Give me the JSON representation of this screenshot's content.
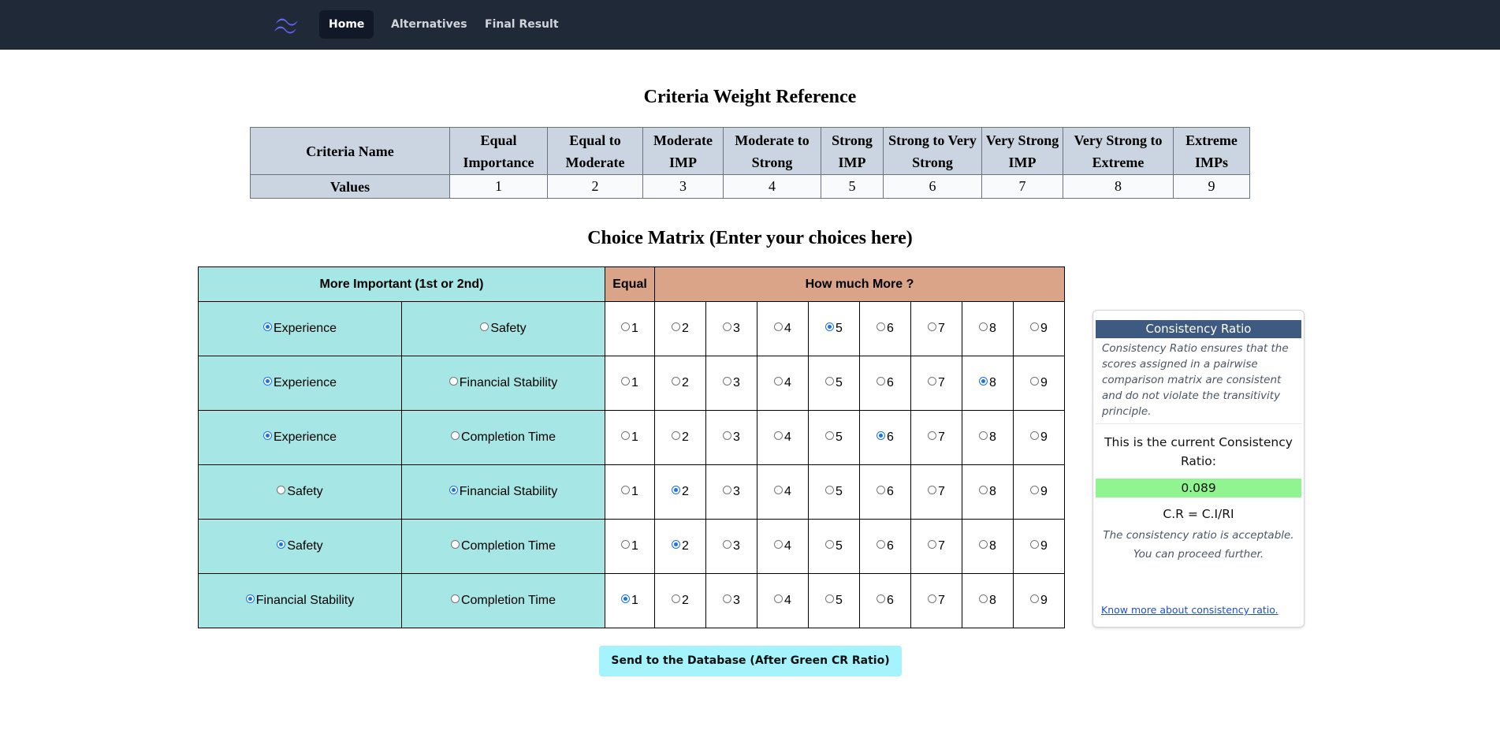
{
  "nav": {
    "logo_icon": "tailwind-wave-icon",
    "items": [
      "Home",
      "Alternatives",
      "Final Result"
    ],
    "active": "Home"
  },
  "reference": {
    "title": "Criteria Weight Reference",
    "header_label": "Criteria Name",
    "values_label": "Values",
    "columns": [
      {
        "name": "Equal Importance",
        "value": "1"
      },
      {
        "name": "Equal to Moderate",
        "value": "2"
      },
      {
        "name": "Moderate IMP",
        "value": "3"
      },
      {
        "name": "Moderate to Strong",
        "value": "4"
      },
      {
        "name": "Strong IMP",
        "value": "5"
      },
      {
        "name": "Strong to Very Strong",
        "value": "6"
      },
      {
        "name": "Very Strong IMP",
        "value": "7"
      },
      {
        "name": "Very Strong to Extreme",
        "value": "8"
      },
      {
        "name": "Extreme IMPs",
        "value": "9"
      }
    ]
  },
  "matrix": {
    "title": "Choice Matrix (Enter your choices here)",
    "header_more_important": "More Important (1st or 2nd)",
    "header_equal": "Equal",
    "header_how_much": "How much More ?",
    "scale": [
      "1",
      "2",
      "3",
      "4",
      "5",
      "6",
      "7",
      "8",
      "9"
    ],
    "rows": [
      {
        "first": "Experience",
        "second": "Safety",
        "selected_side": "first",
        "selected_value": "5"
      },
      {
        "first": "Experience",
        "second": "Financial Stability",
        "selected_side": "first",
        "selected_value": "8"
      },
      {
        "first": "Experience",
        "second": "Completion Time",
        "selected_side": "first",
        "selected_value": "6"
      },
      {
        "first": "Safety",
        "second": "Financial Stability",
        "selected_side": "second",
        "selected_value": "2"
      },
      {
        "first": "Safety",
        "second": "Completion Time",
        "selected_side": "first",
        "selected_value": "2"
      },
      {
        "first": "Financial Stability",
        "second": "Completion Time",
        "selected_side": "first",
        "selected_value": "1"
      }
    ]
  },
  "send_button": "Send to the Database (After Green CR Ratio)",
  "consistency": {
    "title": "Consistency Ratio",
    "description": "Consistency Ratio ensures that the scores assigned in a pairwise comparison matrix are consistent and do not violate the transitivity principle.",
    "current_label": "This is the current Consistency Ratio:",
    "value": "0.089",
    "value_color": "#90f590",
    "formula": "C.R = C.I/RI",
    "acceptable_line1": "The consistency ratio is acceptable.",
    "acceptable_line2": "You can proceed further.",
    "link": "Know more about consistency ratio."
  },
  "colors": {
    "navbar": "#1f2937",
    "teal": "#a6e7e6",
    "salmon": "#d9a488",
    "button": "#a5f3fc",
    "card_header": "#3e5a80"
  }
}
